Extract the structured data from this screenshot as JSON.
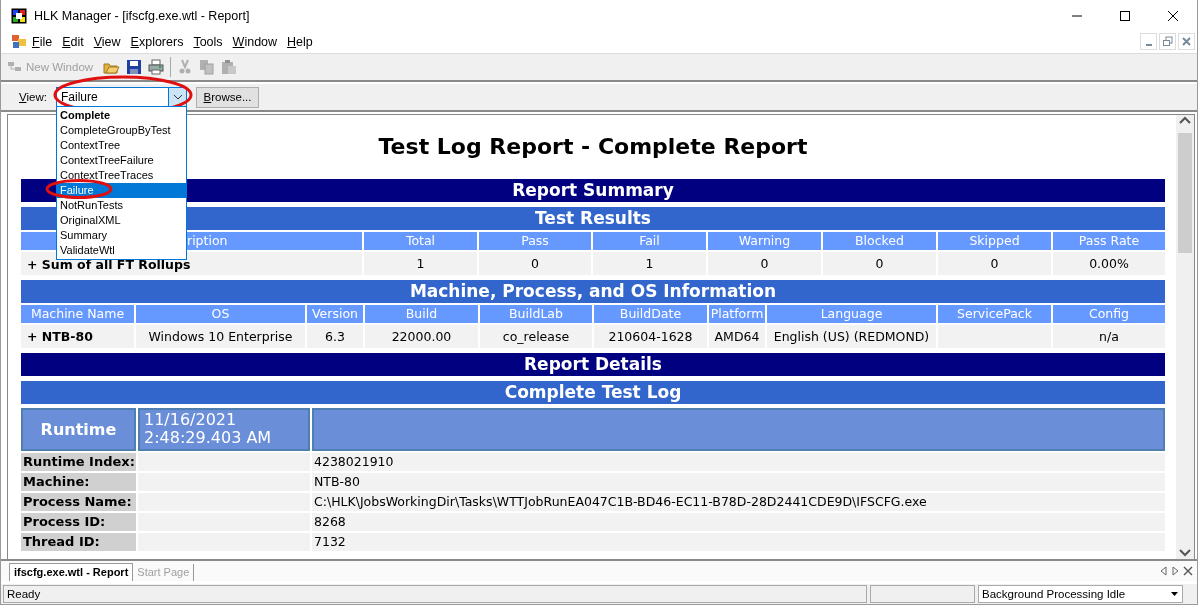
{
  "window": {
    "title": "HLK Manager - [ifscfg.exe.wtl - Report]"
  },
  "menu": [
    "File",
    "Edit",
    "View",
    "Explorers",
    "Tools",
    "Window",
    "Help"
  ],
  "toolbar": {
    "new_window": "New Window"
  },
  "view_bar": {
    "label": "View:",
    "value": "Failure",
    "browse": "Browse...",
    "options": [
      {
        "label": "Complete",
        "selected": false,
        "default": true
      },
      {
        "label": "CompleteGroupByTest",
        "selected": false,
        "default": false
      },
      {
        "label": "ContextTree",
        "selected": false,
        "default": false
      },
      {
        "label": "ContextTreeFailure",
        "selected": false,
        "default": false
      },
      {
        "label": "ContextTreeTraces",
        "selected": false,
        "default": false
      },
      {
        "label": "Failure",
        "selected": true,
        "default": false
      },
      {
        "label": "NotRunTests",
        "selected": false,
        "default": false
      },
      {
        "label": "OriginalXML",
        "selected": false,
        "default": false
      },
      {
        "label": "Summary",
        "selected": false,
        "default": false
      },
      {
        "label": "ValidateWtl",
        "selected": false,
        "default": false
      }
    ]
  },
  "report": {
    "title": "Test Log Report - Complete Report",
    "summary_heading": "Report Summary",
    "test_results": {
      "heading": "Test Results",
      "columns": [
        "ription",
        "Total",
        "Pass",
        "Fail",
        "Warning",
        "Blocked",
        "Skipped",
        "Pass Rate"
      ],
      "rows": [
        [
          "+ Sum of all FT Rollups",
          "1",
          "0",
          "1",
          "0",
          "0",
          "0",
          "0.00%"
        ]
      ]
    },
    "machine_info": {
      "heading": "Machine, Process, and OS Information",
      "columns": [
        "Machine Name",
        "OS",
        "Version",
        "Build",
        "BuildLab",
        "BuildDate",
        "Platform",
        "Language",
        "ServicePack",
        "Config"
      ],
      "rows": [
        [
          "+ NTB-80",
          "Windows 10 Enterprise",
          "6.3",
          "22000.00",
          "co_release",
          "210604-1628",
          "AMD64",
          "English (US) (REDMOND)",
          "",
          "n/a"
        ]
      ]
    },
    "details_heading": "Report Details",
    "log_heading": "Complete Test Log",
    "runtime": {
      "label": "Runtime",
      "time": "11/16/2021 2:48:29.403 AM"
    },
    "fields": [
      {
        "key": "Runtime Index:",
        "value": "4238021910"
      },
      {
        "key": "Machine:",
        "value": "NTB-80"
      },
      {
        "key": "Process Name:",
        "value": "C:\\HLK\\JobsWorkingDir\\Tasks\\WTTJobRunEA047C1B-BD46-EC11-B78D-28D2441CDE9D\\IFSCFG.exe"
      },
      {
        "key": "Process ID:",
        "value": "8268"
      },
      {
        "key": "Thread ID:",
        "value": "7132"
      }
    ]
  },
  "tabs": [
    {
      "label": "ifscfg.exe.wtl - Report",
      "selected": true
    },
    {
      "label": "Start Page",
      "selected": false
    }
  ],
  "status_bar": {
    "text": "Ready",
    "background": "Background Processing Idle"
  }
}
